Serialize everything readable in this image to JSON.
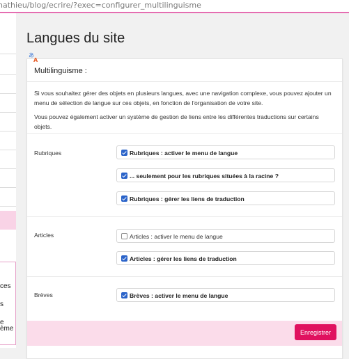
{
  "browser": {
    "url": "nathieu/blog/ecrire/?exec=configurer_multilinguisme"
  },
  "sidebar": {
    "fragments": [
      "ces",
      "s",
      "e",
      "ème"
    ]
  },
  "page": {
    "title": "Langues du site",
    "icon": "translate-icon"
  },
  "form": {
    "title": "Multilinguisme :",
    "intro_1": "Si vous souhaitez gérer des objets en plusieurs langues, avec une navigation complexe, vous pouvez ajouter un menu de sélection de langue sur ces objets, en fonction de l'organisation de votre site.",
    "intro_2": "Vous pouvez également activer un système de gestion de liens entre les différentes traductions sur certains objets.",
    "sections": {
      "rubriques": {
        "label": "Rubriques",
        "options": [
          {
            "label": "Rubriques : activer le menu de langue",
            "checked": true
          },
          {
            "label": "... seulement pour les rubriques situées à la racine ?",
            "checked": true
          },
          {
            "label": "Rubriques : gérer les liens de traduction",
            "checked": true
          }
        ]
      },
      "articles": {
        "label": "Articles",
        "options": [
          {
            "label": "Articles : activer le menu de langue",
            "checked": false
          },
          {
            "label": "Articles : gérer les liens de traduction",
            "checked": true
          }
        ]
      },
      "breves": {
        "label": "Brèves",
        "options": [
          {
            "label": "Brèves : activer le menu de langue",
            "checked": true
          }
        ]
      }
    },
    "save_label": "Enregistrer"
  },
  "colors": {
    "accent": "#e0115f",
    "checkbox": "#2a63c9",
    "highlight": "#f9d3e6"
  }
}
